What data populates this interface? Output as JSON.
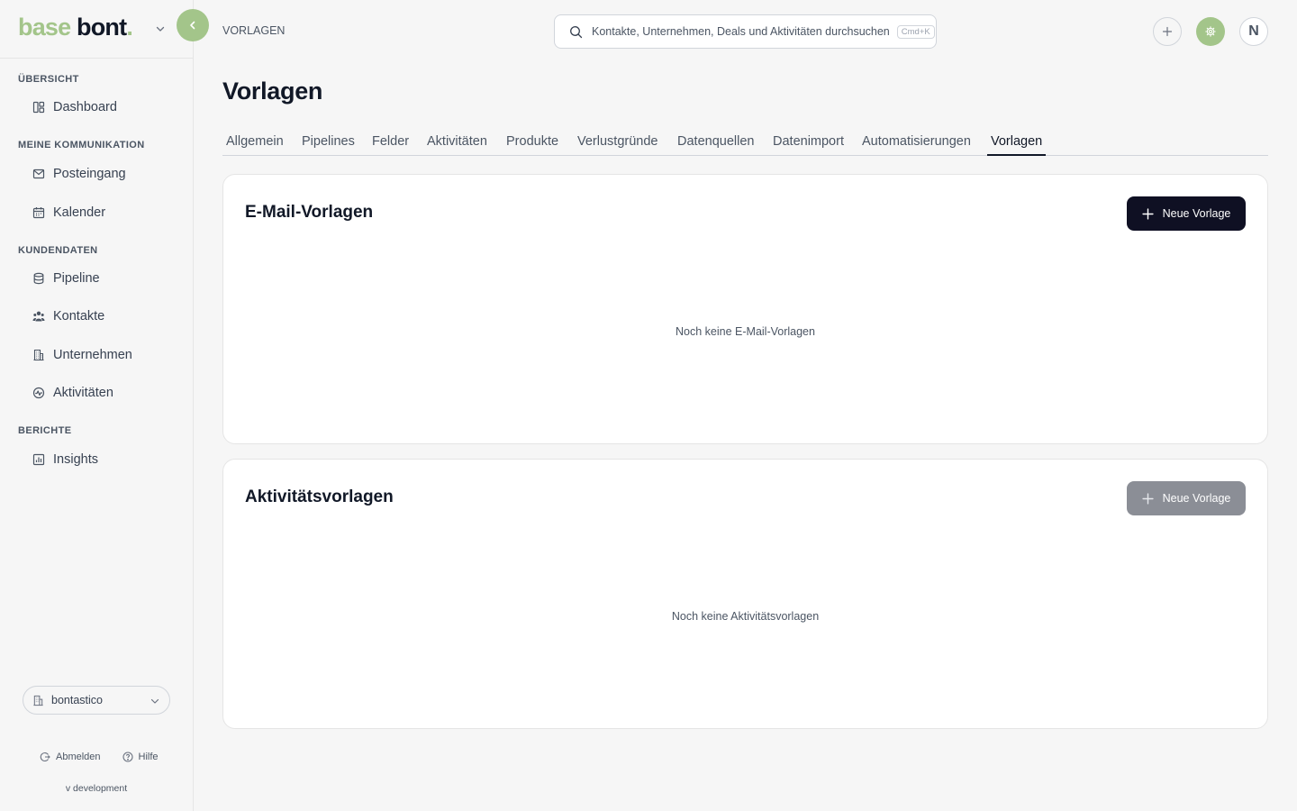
{
  "logo": {
    "part1": "base",
    "part2": "bont",
    "part3": "."
  },
  "sidebar": {
    "sections": [
      {
        "label": "ÜBERSICHT",
        "items": [
          {
            "label": "Dashboard",
            "icon": "dashboard-icon"
          }
        ]
      },
      {
        "label": "MEINE KOMMUNIKATION",
        "items": [
          {
            "label": "Posteingang",
            "icon": "mail-icon"
          },
          {
            "label": "Kalender",
            "icon": "calendar-icon"
          }
        ]
      },
      {
        "label": "KUNDENDATEN",
        "items": [
          {
            "label": "Pipeline",
            "icon": "database-icon"
          },
          {
            "label": "Kontakte",
            "icon": "users-icon"
          },
          {
            "label": "Unternehmen",
            "icon": "building-icon"
          },
          {
            "label": "Aktivitäten",
            "icon": "activity-icon"
          }
        ]
      },
      {
        "label": "BERICHTE",
        "items": [
          {
            "label": "Insights",
            "icon": "chart-icon"
          }
        ]
      }
    ],
    "org": "bontastico",
    "logout": "Abmelden",
    "help": "Hilfe",
    "version": "v development"
  },
  "topbar": {
    "breadcrumb": "VORLAGEN",
    "search_placeholder": "Kontakte, Unternehmen, Deals und Aktivitäten durchsuchen",
    "search_shortcut": "Cmd+K",
    "avatar_initial": "N"
  },
  "page": {
    "title": "Vorlagen",
    "tabs": [
      "Allgemein",
      "Pipelines",
      "Felder",
      "Aktivitäten",
      "Produkte",
      "Verlustgründe",
      "Datenquellen",
      "Datenimport",
      "Automatisierungen",
      "Vorlagen"
    ],
    "active_tab": "Vorlagen"
  },
  "cards": [
    {
      "title": "E-Mail-Vorlagen",
      "button": "Neue Vorlage",
      "empty": "Noch keine E-Mail-Vorlagen",
      "button_enabled": true
    },
    {
      "title": "Aktivitätsvorlagen",
      "button": "Neue Vorlage",
      "empty": "Noch keine Aktivitätsvorlagen",
      "button_enabled": false
    }
  ],
  "colors": {
    "accent": "#a3c58a",
    "primary_button": "#0f1023",
    "disabled_button": "#8b8e96"
  }
}
